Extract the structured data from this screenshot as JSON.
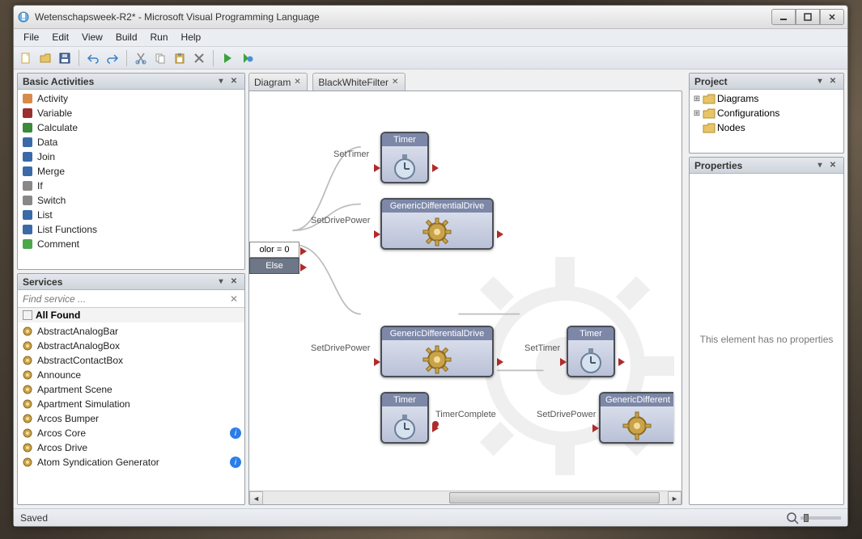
{
  "window": {
    "title": "Wetenschapsweek-R2* - Microsoft Visual Programming Language"
  },
  "menu": [
    "File",
    "Edit",
    "View",
    "Build",
    "Run",
    "Help"
  ],
  "panels": {
    "basic": {
      "title": "Basic Activities",
      "items": [
        "Activity",
        "Variable",
        "Calculate",
        "Data",
        "Join",
        "Merge",
        "If",
        "Switch",
        "List",
        "List Functions",
        "Comment"
      ]
    },
    "services": {
      "title": "Services",
      "search_placeholder": "Find service ...",
      "all_found": "All Found",
      "items": [
        {
          "label": "AbstractAnalogBar",
          "info": false
        },
        {
          "label": "AbstractAnalogBox",
          "info": false
        },
        {
          "label": "AbstractContactBox",
          "info": false
        },
        {
          "label": "Announce",
          "info": false
        },
        {
          "label": "Apartment Scene",
          "info": false
        },
        {
          "label": "Apartment Simulation",
          "info": false
        },
        {
          "label": "Arcos Bumper",
          "info": false
        },
        {
          "label": "Arcos Core",
          "info": true
        },
        {
          "label": "Arcos Drive",
          "info": false
        },
        {
          "label": "Atom Syndication Generator",
          "info": true
        }
      ]
    },
    "project": {
      "title": "Project",
      "items": [
        "Diagrams",
        "Configurations",
        "Nodes"
      ]
    },
    "properties": {
      "title": "Properties",
      "empty": "This element has no properties"
    }
  },
  "tabs": [
    "Diagram",
    "BlackWhiteFilter"
  ],
  "canvas": {
    "ifblock": {
      "condition": "olor = 0",
      "else": "Else"
    },
    "nodes": {
      "timer1": "Timer",
      "gdd1": "GenericDifferentialDrive",
      "gdd2": "GenericDifferentialDrive",
      "timer2": "Timer",
      "timer3": "Timer",
      "gdd3": "GenericDifferent"
    },
    "labels": {
      "setTimer1": "SetTimer",
      "setDrivePower1": "SetDrivePower",
      "setDrivePower2": "SetDrivePower",
      "setTimer2": "SetTimer",
      "timerComplete": "TimerComplete",
      "setDrivePower3": "SetDrivePower"
    }
  },
  "status": {
    "text": "Saved"
  }
}
